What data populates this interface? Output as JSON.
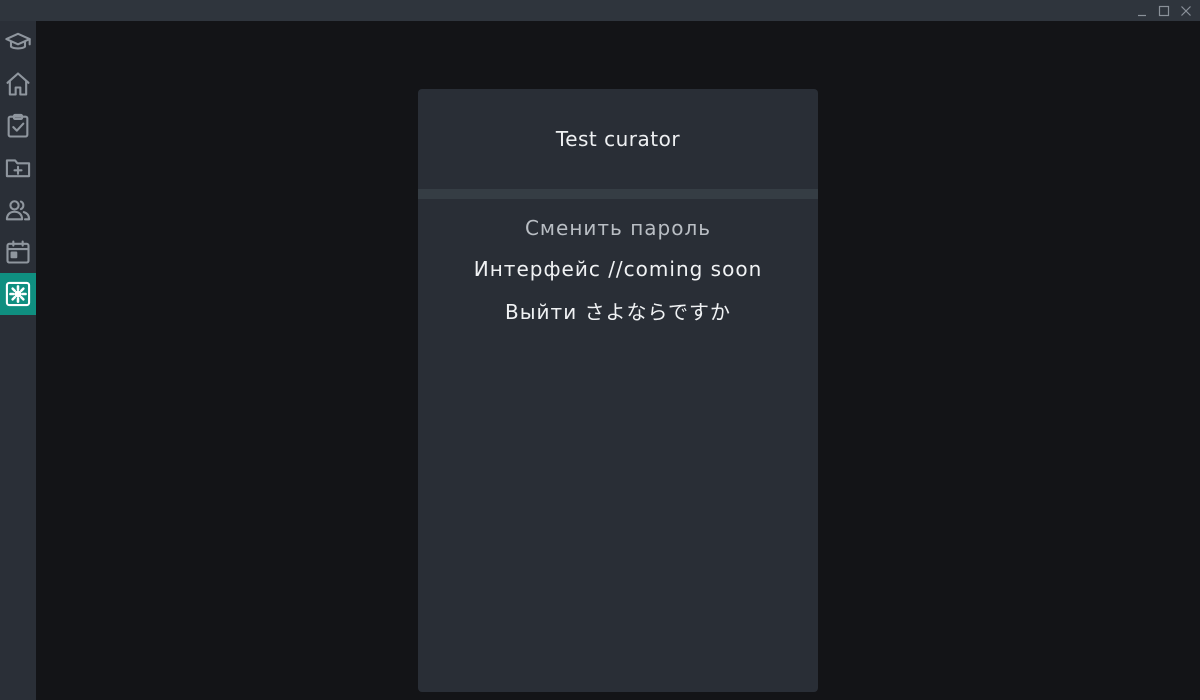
{
  "window": {
    "controls": [
      "minimize",
      "maximize",
      "close"
    ]
  },
  "sidebar": {
    "items": [
      {
        "id": "courses",
        "icon": "graduation-cap-icon",
        "active": false
      },
      {
        "id": "home",
        "icon": "home-icon",
        "active": false
      },
      {
        "id": "tasks",
        "icon": "clipboard-check-icon",
        "active": false
      },
      {
        "id": "folders",
        "icon": "folder-plus-icon",
        "active": false
      },
      {
        "id": "users",
        "icon": "users-icon",
        "active": false
      },
      {
        "id": "calendar",
        "icon": "calendar-icon",
        "active": false
      },
      {
        "id": "settings",
        "icon": "settings-icon",
        "active": true
      }
    ],
    "accent": "#0f8f80"
  },
  "profile": {
    "name": "Test curator"
  },
  "menu": {
    "change_password": "Сменить пароль",
    "interface": "Интерфейс //coming soon",
    "logout": "Выйти さよならですか"
  }
}
